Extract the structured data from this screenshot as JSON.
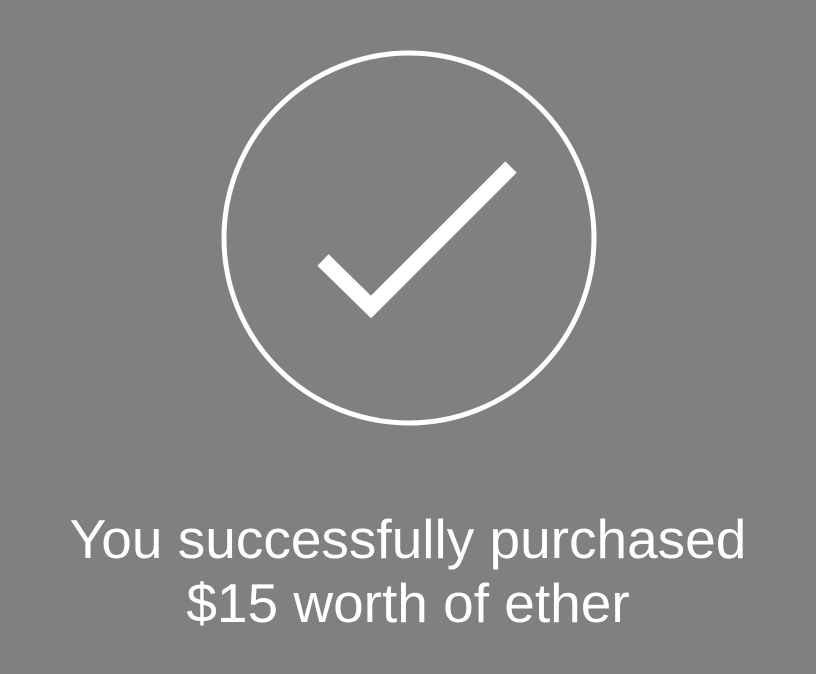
{
  "screen": {
    "background_color": "#808080",
    "foreground_color": "#ffffff"
  },
  "success_icon": {
    "name": "checkmark-in-circle-icon"
  },
  "message": {
    "line_1": "You successfully purchased",
    "line_2": "$15 worth of ether"
  }
}
